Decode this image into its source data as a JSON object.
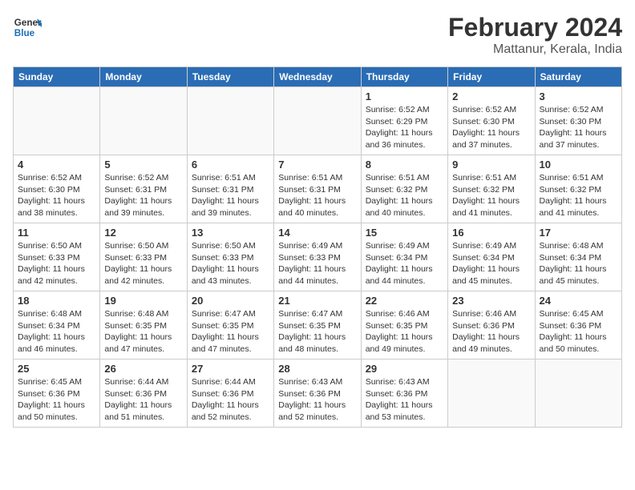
{
  "logo": {
    "line1": "General",
    "line2": "Blue"
  },
  "title": "February 2024",
  "subtitle": "Mattanur, Kerala, India",
  "weekdays": [
    "Sunday",
    "Monday",
    "Tuesday",
    "Wednesday",
    "Thursday",
    "Friday",
    "Saturday"
  ],
  "weeks": [
    [
      {
        "day": "",
        "info": ""
      },
      {
        "day": "",
        "info": ""
      },
      {
        "day": "",
        "info": ""
      },
      {
        "day": "",
        "info": ""
      },
      {
        "day": "1",
        "info": "Sunrise: 6:52 AM\nSunset: 6:29 PM\nDaylight: 11 hours\nand 36 minutes."
      },
      {
        "day": "2",
        "info": "Sunrise: 6:52 AM\nSunset: 6:30 PM\nDaylight: 11 hours\nand 37 minutes."
      },
      {
        "day": "3",
        "info": "Sunrise: 6:52 AM\nSunset: 6:30 PM\nDaylight: 11 hours\nand 37 minutes."
      }
    ],
    [
      {
        "day": "4",
        "info": "Sunrise: 6:52 AM\nSunset: 6:30 PM\nDaylight: 11 hours\nand 38 minutes."
      },
      {
        "day": "5",
        "info": "Sunrise: 6:52 AM\nSunset: 6:31 PM\nDaylight: 11 hours\nand 39 minutes."
      },
      {
        "day": "6",
        "info": "Sunrise: 6:51 AM\nSunset: 6:31 PM\nDaylight: 11 hours\nand 39 minutes."
      },
      {
        "day": "7",
        "info": "Sunrise: 6:51 AM\nSunset: 6:31 PM\nDaylight: 11 hours\nand 40 minutes."
      },
      {
        "day": "8",
        "info": "Sunrise: 6:51 AM\nSunset: 6:32 PM\nDaylight: 11 hours\nand 40 minutes."
      },
      {
        "day": "9",
        "info": "Sunrise: 6:51 AM\nSunset: 6:32 PM\nDaylight: 11 hours\nand 41 minutes."
      },
      {
        "day": "10",
        "info": "Sunrise: 6:51 AM\nSunset: 6:32 PM\nDaylight: 11 hours\nand 41 minutes."
      }
    ],
    [
      {
        "day": "11",
        "info": "Sunrise: 6:50 AM\nSunset: 6:33 PM\nDaylight: 11 hours\nand 42 minutes."
      },
      {
        "day": "12",
        "info": "Sunrise: 6:50 AM\nSunset: 6:33 PM\nDaylight: 11 hours\nand 42 minutes."
      },
      {
        "day": "13",
        "info": "Sunrise: 6:50 AM\nSunset: 6:33 PM\nDaylight: 11 hours\nand 43 minutes."
      },
      {
        "day": "14",
        "info": "Sunrise: 6:49 AM\nSunset: 6:33 PM\nDaylight: 11 hours\nand 44 minutes."
      },
      {
        "day": "15",
        "info": "Sunrise: 6:49 AM\nSunset: 6:34 PM\nDaylight: 11 hours\nand 44 minutes."
      },
      {
        "day": "16",
        "info": "Sunrise: 6:49 AM\nSunset: 6:34 PM\nDaylight: 11 hours\nand 45 minutes."
      },
      {
        "day": "17",
        "info": "Sunrise: 6:48 AM\nSunset: 6:34 PM\nDaylight: 11 hours\nand 45 minutes."
      }
    ],
    [
      {
        "day": "18",
        "info": "Sunrise: 6:48 AM\nSunset: 6:34 PM\nDaylight: 11 hours\nand 46 minutes."
      },
      {
        "day": "19",
        "info": "Sunrise: 6:48 AM\nSunset: 6:35 PM\nDaylight: 11 hours\nand 47 minutes."
      },
      {
        "day": "20",
        "info": "Sunrise: 6:47 AM\nSunset: 6:35 PM\nDaylight: 11 hours\nand 47 minutes."
      },
      {
        "day": "21",
        "info": "Sunrise: 6:47 AM\nSunset: 6:35 PM\nDaylight: 11 hours\nand 48 minutes."
      },
      {
        "day": "22",
        "info": "Sunrise: 6:46 AM\nSunset: 6:35 PM\nDaylight: 11 hours\nand 49 minutes."
      },
      {
        "day": "23",
        "info": "Sunrise: 6:46 AM\nSunset: 6:36 PM\nDaylight: 11 hours\nand 49 minutes."
      },
      {
        "day": "24",
        "info": "Sunrise: 6:45 AM\nSunset: 6:36 PM\nDaylight: 11 hours\nand 50 minutes."
      }
    ],
    [
      {
        "day": "25",
        "info": "Sunrise: 6:45 AM\nSunset: 6:36 PM\nDaylight: 11 hours\nand 50 minutes."
      },
      {
        "day": "26",
        "info": "Sunrise: 6:44 AM\nSunset: 6:36 PM\nDaylight: 11 hours\nand 51 minutes."
      },
      {
        "day": "27",
        "info": "Sunrise: 6:44 AM\nSunset: 6:36 PM\nDaylight: 11 hours\nand 52 minutes."
      },
      {
        "day": "28",
        "info": "Sunrise: 6:43 AM\nSunset: 6:36 PM\nDaylight: 11 hours\nand 52 minutes."
      },
      {
        "day": "29",
        "info": "Sunrise: 6:43 AM\nSunset: 6:36 PM\nDaylight: 11 hours\nand 53 minutes."
      },
      {
        "day": "",
        "info": ""
      },
      {
        "day": "",
        "info": ""
      }
    ]
  ]
}
